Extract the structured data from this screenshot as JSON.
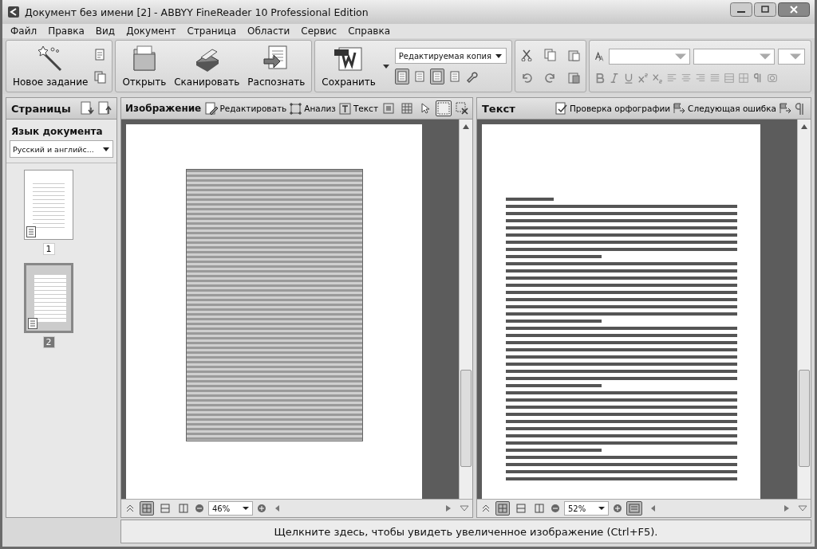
{
  "window": {
    "title": "Документ без имени [2] - ABBYY FineReader 10 Professional Edition"
  },
  "menu": [
    "Файл",
    "Правка",
    "Вид",
    "Документ",
    "Страница",
    "Области",
    "Сервис",
    "Справка"
  ],
  "toolbar": {
    "new_task": "Новое задание",
    "actions": [
      {
        "label": "Открыть",
        "kind": "open"
      },
      {
        "label": "Сканировать",
        "kind": "scan"
      },
      {
        "label": "Распознать",
        "kind": "recognize"
      }
    ],
    "save": "Сохранить",
    "save_format": "Редактируемая копия",
    "view_modes": [
      {
        "selected": true
      },
      {
        "selected": false
      },
      {
        "selected": true
      },
      {
        "selected": false
      }
    ]
  },
  "sidebar": {
    "title": "Страницы",
    "language_label": "Язык документа",
    "language": "Русский и английс...",
    "pages": [
      {
        "number": "1",
        "selected": false
      },
      {
        "number": "2",
        "selected": true
      }
    ]
  },
  "image_pane": {
    "title": "Изображение",
    "tools": [
      "Редактировать",
      "Анализ",
      "Текст"
    ],
    "icon_tools": [
      {
        "selected": false
      },
      {
        "selected": false
      },
      {
        "selected": false
      },
      {
        "selected": true
      },
      {
        "selected": false
      }
    ],
    "zoom": "46%"
  },
  "text_pane": {
    "title": "Текст",
    "tools": [
      "Проверка орфографии",
      "Следующая ошибка"
    ],
    "zoom": "52%"
  },
  "status_bar": "Щелкните здесь, чтобы увидеть увеличенное изображение (Ctrl+F5)."
}
